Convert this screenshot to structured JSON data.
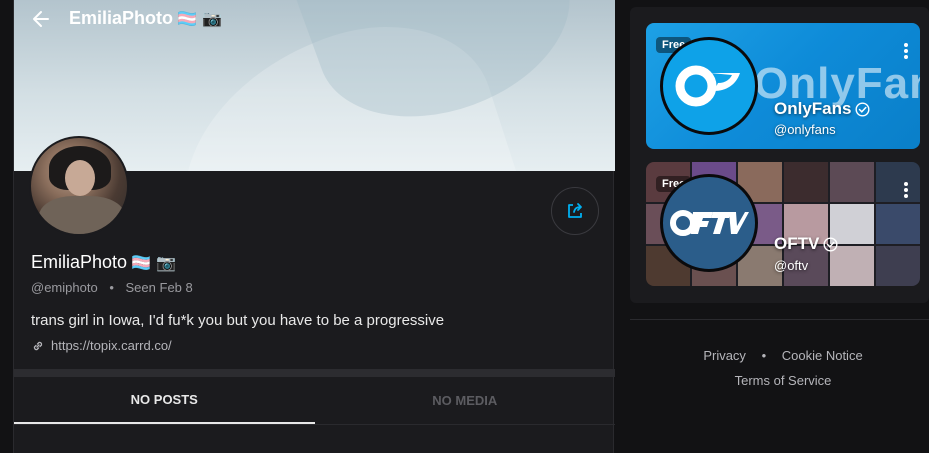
{
  "header": {
    "title": "EmiliaPhoto",
    "emojis": "🏳️‍⚧️ 📷"
  },
  "profile": {
    "display_name": "EmiliaPhoto",
    "emojis": "🏳️‍⚧️ 📷",
    "handle": "@emiphoto",
    "seen_label": "Seen",
    "seen_date": "Feb 8",
    "bio": "trans girl in Iowa, I'd fu*k you but you have to be a progressive",
    "link": "https://topix.carrd.co/"
  },
  "tabs": [
    {
      "label": "NO POSTS",
      "active": true
    },
    {
      "label": "NO MEDIA",
      "active": false
    }
  ],
  "suggestions": [
    {
      "badge": "Free",
      "name": "OnlyFans",
      "handle": "@onlyfans",
      "wordmark": "OnlyFans"
    },
    {
      "badge": "Free",
      "name": "OFTV",
      "handle": "@oftv"
    }
  ],
  "footer": {
    "privacy": "Privacy",
    "cookie": "Cookie Notice",
    "terms": "Terms of Service"
  },
  "colors": {
    "accent": "#00aff0",
    "background": "#121214",
    "panel": "#1b1b1e"
  }
}
